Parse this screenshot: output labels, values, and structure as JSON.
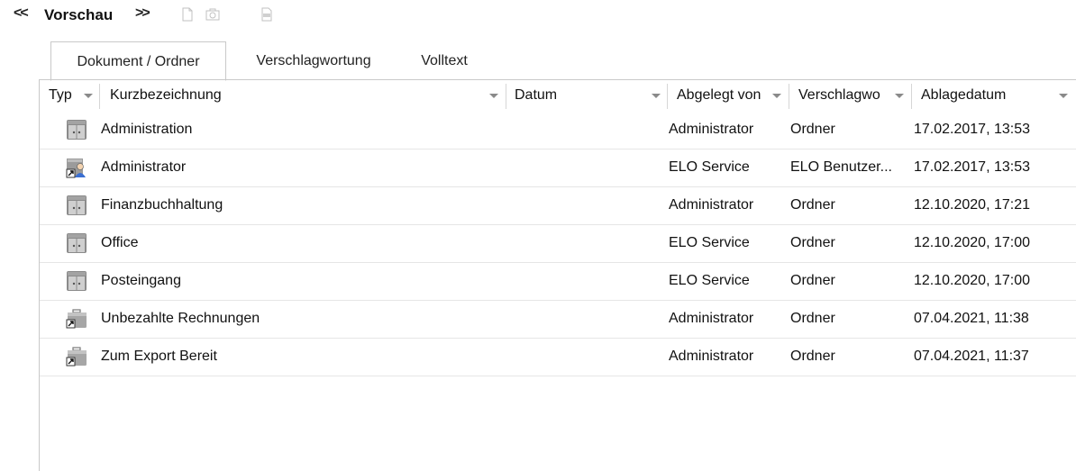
{
  "toolbar": {
    "back_icon": "double-chevron-left-icon",
    "back_label": "<<",
    "title": "Vorschau",
    "forward_label": ">>",
    "icons": [
      "document-icon",
      "camera-icon",
      "pdf-icon"
    ]
  },
  "tabs": [
    {
      "label": "Dokument / Ordner",
      "active": true
    },
    {
      "label": "Verschlagwortung",
      "active": false
    },
    {
      "label": "Volltext",
      "active": false
    }
  ],
  "columns": [
    {
      "label": "Typ"
    },
    {
      "label": "Kurzbezeichnung"
    },
    {
      "label": "Datum"
    },
    {
      "label": "Abgelegt von"
    },
    {
      "label": "Verschlagwo"
    },
    {
      "label": "Ablagedatum"
    }
  ],
  "rows": [
    {
      "icon": "cabinet-icon",
      "name": "Administration",
      "datum": "",
      "abgelegt": "Administrator",
      "verschlagwortung": "Ordner",
      "ablagedatum": "17.02.2017, 13:53"
    },
    {
      "icon": "user-folder-icon",
      "name": "Administrator",
      "datum": "",
      "abgelegt": "ELO Service",
      "verschlagwortung": "ELO Benutzer...",
      "ablagedatum": "17.02.2017, 13:53"
    },
    {
      "icon": "cabinet-icon",
      "name": "Finanzbuchhaltung",
      "datum": "",
      "abgelegt": "Administrator",
      "verschlagwortung": "Ordner",
      "ablagedatum": "12.10.2020, 17:21"
    },
    {
      "icon": "cabinet-icon",
      "name": "Office",
      "datum": "",
      "abgelegt": "ELO Service",
      "verschlagwortung": "Ordner",
      "ablagedatum": "12.10.2020, 17:00"
    },
    {
      "icon": "cabinet-icon",
      "name": "Posteingang",
      "datum": "",
      "abgelegt": "ELO Service",
      "verschlagwortung": "Ordner",
      "ablagedatum": "12.10.2020, 17:00"
    },
    {
      "icon": "briefcase-link-icon",
      "name": "Unbezahlte Rechnungen",
      "datum": "",
      "abgelegt": "Administrator",
      "verschlagwortung": "Ordner",
      "ablagedatum": "07.04.2021, 11:38"
    },
    {
      "icon": "briefcase-link-icon",
      "name": "Zum Export Bereit",
      "datum": "",
      "abgelegt": "Administrator",
      "verschlagwortung": "Ordner",
      "ablagedatum": "07.04.2021, 11:37"
    }
  ]
}
